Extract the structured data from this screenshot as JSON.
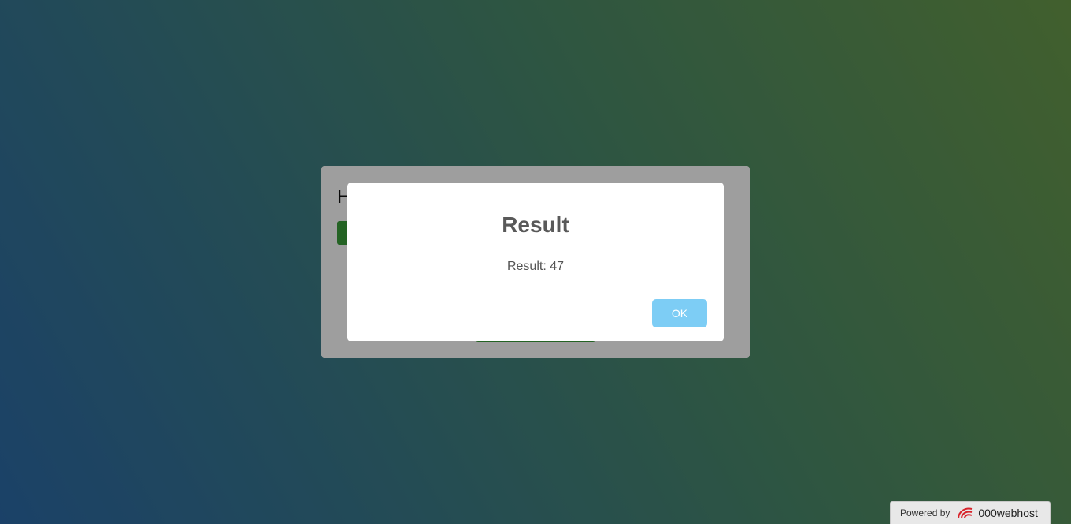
{
  "page": {
    "card_title": "H"
  },
  "modal": {
    "title": "Result",
    "text": "Result: 47",
    "ok_label": "OK"
  },
  "badge": {
    "powered_by": "Powered by",
    "brand": "000webhost",
    "logo_icon": "000webhost-logo-icon"
  },
  "colors": {
    "ok_button": "#7dcdf5",
    "overlay": "rgba(0,0,0,0.38)",
    "card_button": "#3aa03a"
  }
}
